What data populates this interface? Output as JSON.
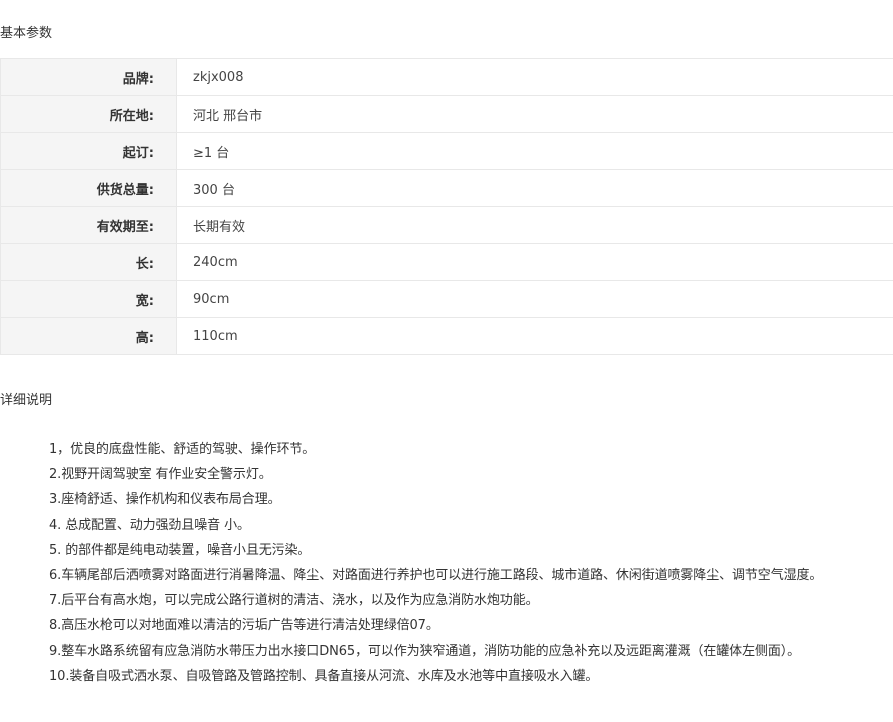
{
  "sections": {
    "basic_title": "基本参数",
    "detail_title": "详细说明"
  },
  "params": [
    {
      "label": "品牌:",
      "value": "zkjx008"
    },
    {
      "label": "所在地:",
      "value": "河北 邢台市"
    },
    {
      "label": "起订:",
      "value": "≥1 台"
    },
    {
      "label": "供货总量:",
      "value": "300 台"
    },
    {
      "label": "有效期至:",
      "value": "长期有效"
    },
    {
      "label": "长:",
      "value": "240cm"
    },
    {
      "label": "宽:",
      "value": "90cm"
    },
    {
      "label": "高:",
      "value": "110cm"
    }
  ],
  "details": [
    "1，优良的底盘性能、舒适的驾驶、操作环节。",
    "2.视野开阔驾驶室 有作业安全警示灯。",
    "3.座椅舒适、操作机构和仪表布局合理。",
    "4. 总成配置、动力强劲且噪音 小。",
    "5. 的部件都是纯电动装置，噪音小且无污染。",
    "6.车辆尾部后洒喷雾对路面进行消暑降温、降尘、对路面进行养护也可以进行施工路段、城市道路、休闲街道喷雾降尘、调节空气湿度。",
    "7.后平台有高水炮，可以完成公路行道树的清洁、浇水，以及作为应急消防水炮功能。",
    "8.高压水枪可以对地面难以清洁的污垢广告等进行清洁处理绿倍07。",
    "9.整车水路系统留有应急消防水带压力出水接口DN65，可以作为狭窄通道，消防功能的应急补充以及远距离灌溉（在罐体左侧面）。",
    "10.装备自吸式洒水泵、自吸管路及管路控制、具备直接从河流、水库及水池等中直接吸水入罐。"
  ]
}
